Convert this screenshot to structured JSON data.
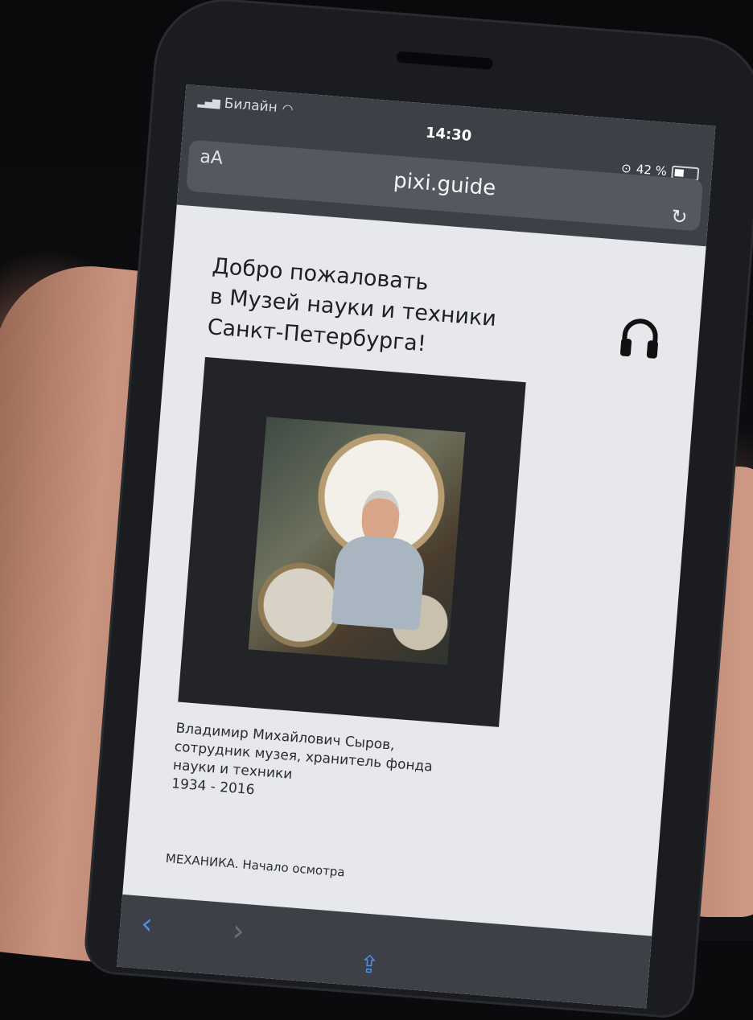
{
  "status_bar": {
    "carrier": "Билайн",
    "time": "14:30",
    "battery": "42 %"
  },
  "browser": {
    "text_size_label": "aA",
    "url": "pixi.guide"
  },
  "page": {
    "title_lines": [
      "Добро пожаловать",
      "в Музей науки и техники",
      "Санкт-Петербурга!"
    ],
    "caption_lines": [
      "Владимир Михайлович Сыров,",
      "сотрудник музея, хранитель фонда",
      "науки и техники",
      "1934 - 2016"
    ],
    "section_label": "МЕХАНИКА. Начало осмотра"
  },
  "icons": {
    "audio": "headphones-icon",
    "reload": "reload-icon",
    "back": "back-icon",
    "forward": "forward-icon",
    "share": "share-icon"
  },
  "colors": {
    "browser_chrome": "#3d4046",
    "page_background": "#e6e8ec",
    "accent_blue": "#4b8fe8"
  }
}
